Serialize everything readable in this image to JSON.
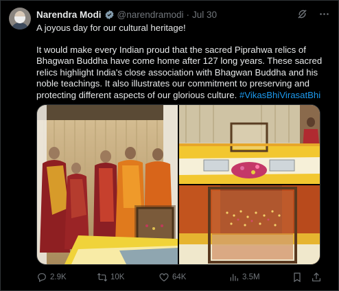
{
  "user": {
    "display_name": "Narendra Modi",
    "handle": "@narendramodi",
    "separator": "·",
    "date": "Jul 30"
  },
  "tweet": {
    "line1": "A joyous day for our cultural heritage!",
    "line2": "It would make every Indian proud that the sacred Piprahwa relics of Bhagwan Buddha have come home after 127 long years. These sacred relics highlight India's close association with Bhagwan Buddha and his noble teachings. It also illustrates our commitment to preserving and protecting different aspects of our glorious culture.",
    "hashtag": "#VikasBhiVirasatBhi"
  },
  "header_icons": [
    "grok-icon",
    "more-icon"
  ],
  "stats": {
    "replies": "2.9K",
    "reposts": "10K",
    "likes": "64K",
    "views": "3.5M"
  },
  "action_icons": [
    "reply-icon",
    "repost-icon",
    "like-icon",
    "views-icon",
    "bookmark-icon",
    "share-icon"
  ],
  "colors": {
    "background": "#000000",
    "text": "#e7e9ea",
    "secondary": "#71767b",
    "accent": "#1d9bf0",
    "border": "#2f3336"
  }
}
